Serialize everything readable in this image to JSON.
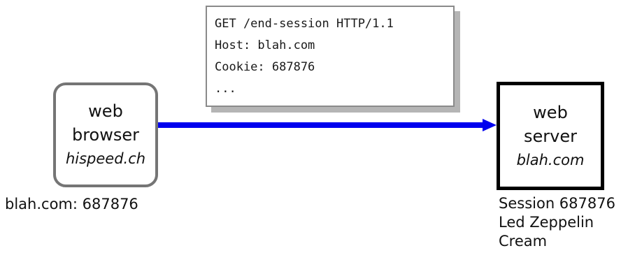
{
  "browser": {
    "name_line1": "web",
    "name_line2": "browser",
    "domain": "hispeed.ch"
  },
  "server": {
    "name_line1": "web",
    "name_line2": "server",
    "domain": "blah.com"
  },
  "request": {
    "lines": [
      "GET /end-session HTTP/1.1",
      "Host: blah.com",
      "Cookie: 687876",
      "..."
    ]
  },
  "browser_cookie": "blah.com: 687876",
  "server_session": {
    "lines": [
      "Session 687876",
      "Led Zeppelin",
      "Cream"
    ]
  },
  "colors": {
    "arrow": "#0000ee",
    "browser_border": "#757575",
    "server_border": "#000000",
    "request_shadow": "#b5b5b5"
  }
}
